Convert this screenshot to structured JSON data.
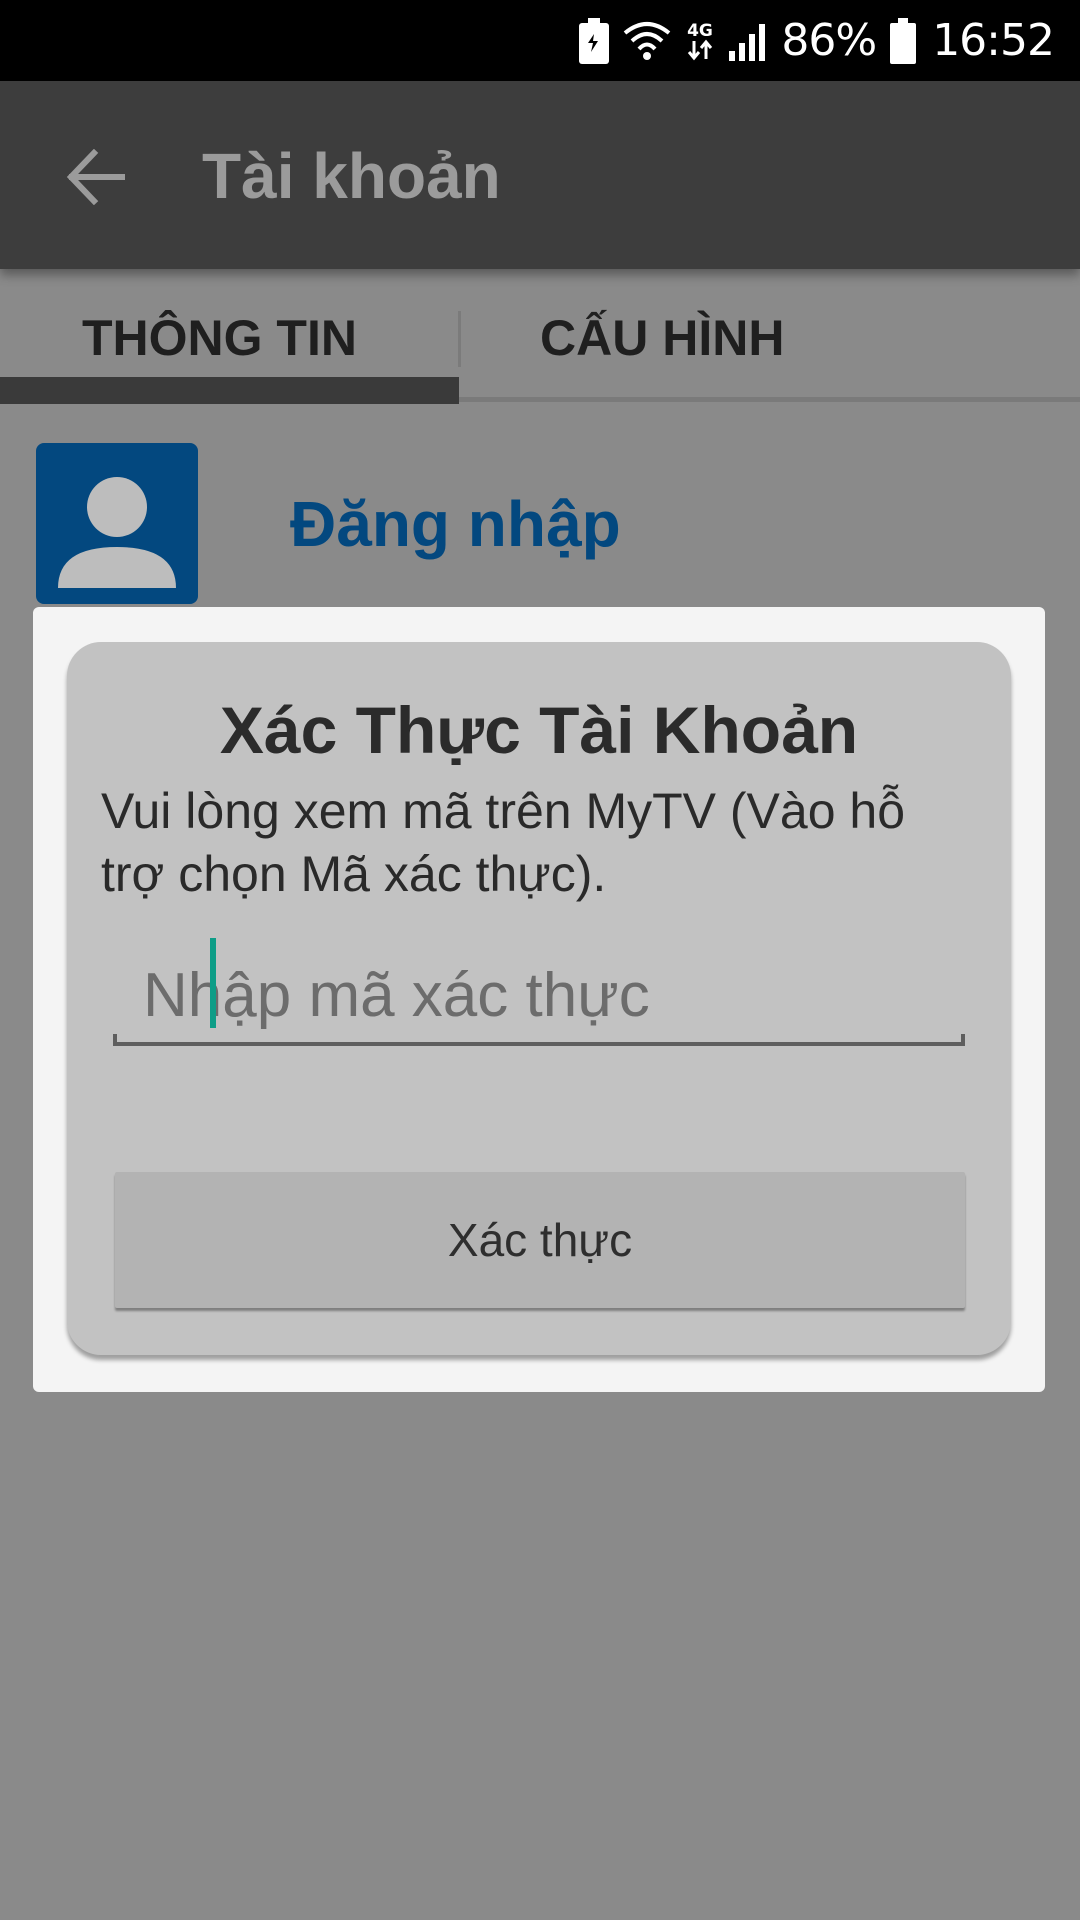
{
  "status_bar": {
    "battery_percent": "86%",
    "time": "16:52",
    "network_type": "4G",
    "icons": [
      "battery-saver-icon",
      "wifi-icon",
      "mobile-data-icon",
      "signal-icon",
      "battery-icon"
    ]
  },
  "app_bar": {
    "title": "Tài khoản",
    "back_icon": "arrow-back-icon"
  },
  "tabs": [
    {
      "label": "THÔNG TIN",
      "selected": true
    },
    {
      "label": "CẤU HÌNH",
      "selected": false
    }
  ],
  "profile": {
    "avatar_icon": "person-icon",
    "login_label": "Đăng nhập"
  },
  "dialog": {
    "title": "Xác Thực Tài Khoản",
    "message": "Vui lòng xem mã trên MyTV (Vào hỗ trợ chọn Mã xác thực).",
    "input": {
      "value": "",
      "placeholder": "Nhập mã xác thực"
    },
    "submit_label": "Xác thực"
  },
  "colors": {
    "brand_blue": "#03487f",
    "app_bar": "#3d3d3d",
    "cursor_accent": "#0e9d87",
    "scrim": "#8a8a8a"
  }
}
